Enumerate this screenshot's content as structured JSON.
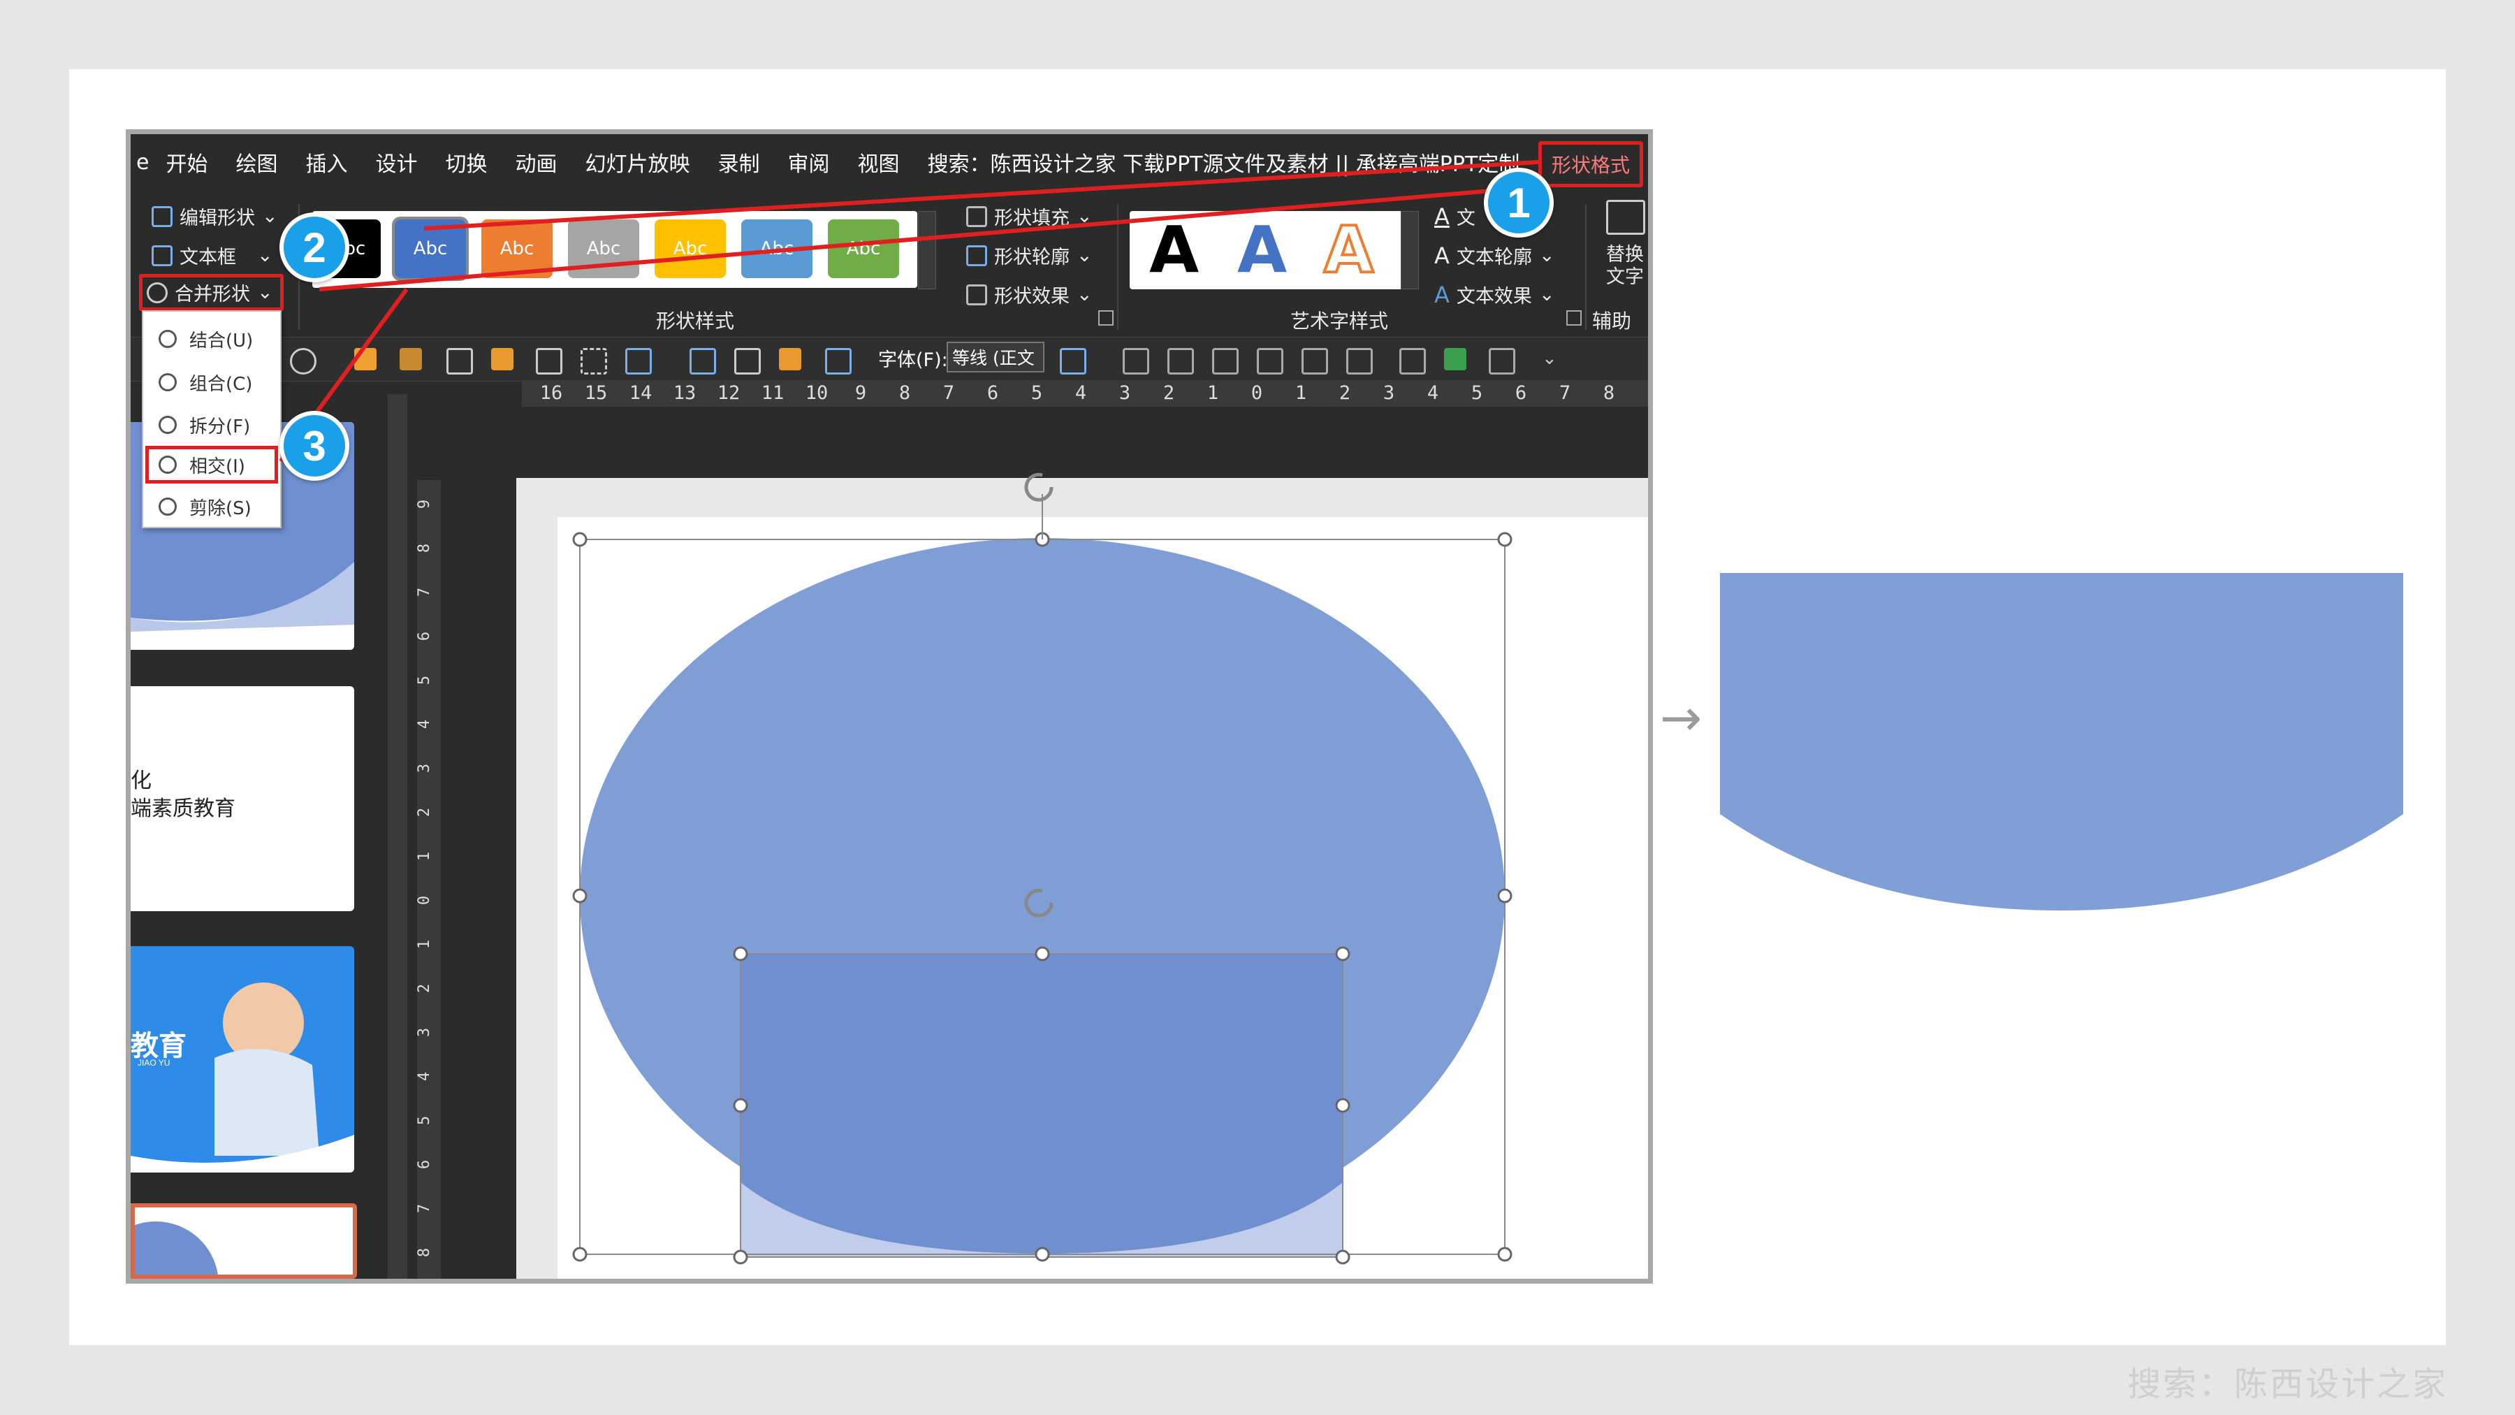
{
  "watermark": "搜索：陈西设计之家",
  "menu": {
    "items": [
      "e",
      "开始",
      "绘图",
      "插入",
      "设计",
      "切换",
      "动画",
      "幻灯片放映",
      "录制",
      "审阅",
      "视图"
    ],
    "search": "搜索：陈西设计之家  下载PPT源文件及素材 || 承接高端PPT定制",
    "active_tab": "形状格式"
  },
  "ribbon": {
    "edit_shape": "编辑形状",
    "text_box": "文本框",
    "merge_shapes": "合并形状",
    "style_swatches": [
      {
        "label": "Abc",
        "color": "#000000"
      },
      {
        "label": "Abc",
        "color": "#4472c4"
      },
      {
        "label": "Abc",
        "color": "#ed7d31"
      },
      {
        "label": "Abc",
        "color": "#a5a5a5"
      },
      {
        "label": "Abc",
        "color": "#ffc000"
      },
      {
        "label": "Abc",
        "color": "#5b9bd5"
      },
      {
        "label": "Abc",
        "color": "#70ad47"
      }
    ],
    "shape_fill": "形状填充",
    "shape_outline": "形状轮廓",
    "shape_effects": "形状效果",
    "shape_styles_label": "形状样式",
    "wordart_letters": [
      "A",
      "A",
      "A"
    ],
    "text_fill": "文",
    "text_outline": "文本轮廓",
    "text_effects": "文本效果",
    "wordart_label": "艺术字样式",
    "alt_text_1": "替换",
    "alt_text_2": "文字",
    "accessibility": "辅助功"
  },
  "toolbar2": {
    "font_label": "字体(F):",
    "font_value": "等线 (正文"
  },
  "merge_menu": {
    "items": [
      "结合(U)",
      "组合(C)",
      "拆分(F)",
      "相交(I)",
      "剪除(S)"
    ],
    "selected_index": 3
  },
  "ruler": {
    "horizontal": [
      "16",
      "15",
      "14",
      "13",
      "12",
      "11",
      "10",
      "9",
      "8",
      "7",
      "6",
      "5",
      "4",
      "3",
      "2",
      "1",
      "0",
      "1",
      "2",
      "3",
      "4",
      "5",
      "6",
      "7",
      "8"
    ],
    "vertical": [
      "9",
      "8",
      "7",
      "6",
      "5",
      "4",
      "3",
      "2",
      "1",
      "0",
      "1",
      "2",
      "3",
      "4",
      "5",
      "6",
      "7",
      "8"
    ]
  },
  "thumbnails": {
    "slide2_line1": "化",
    "slide2_line2": "端素质教育",
    "slide3_title": "教育",
    "slide3_sub": "JIAO YU"
  },
  "steps": [
    "1",
    "2",
    "3"
  ],
  "arrow": "→",
  "colors": {
    "shape_fill": "#7b9bd4",
    "rect_fill": "#6f8fd0",
    "accent_red": "#e02020",
    "badge": "#1aa0e8"
  }
}
